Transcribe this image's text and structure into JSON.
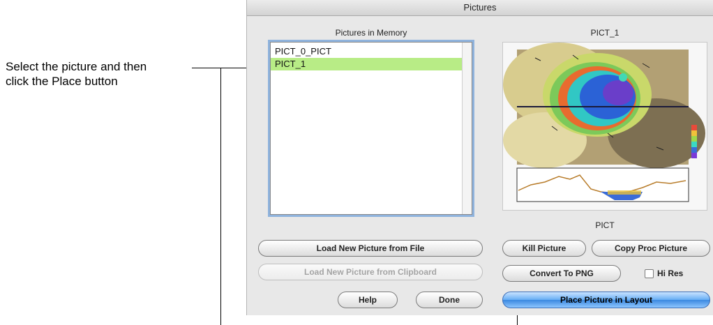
{
  "annotation": {
    "line1": "Select the picture and then",
    "line2": "click the Place button"
  },
  "window": {
    "title": "Pictures",
    "list_header": "Pictures in Memory",
    "preview_title": "PICT_1",
    "items": [
      "PICT_0_PICT",
      "PICT_1"
    ],
    "selected_index": 1,
    "format_label": "PICT",
    "buttons": {
      "load_file": "Load New Picture from File",
      "load_clipboard": "Load New Picture from Clipboard",
      "kill": "Kill Picture",
      "copy_proc": "Copy Proc Picture",
      "convert_png": "Convert To PNG",
      "hi_res": "Hi Res",
      "help": "Help",
      "done": "Done",
      "place": "Place Picture in Layout"
    }
  }
}
